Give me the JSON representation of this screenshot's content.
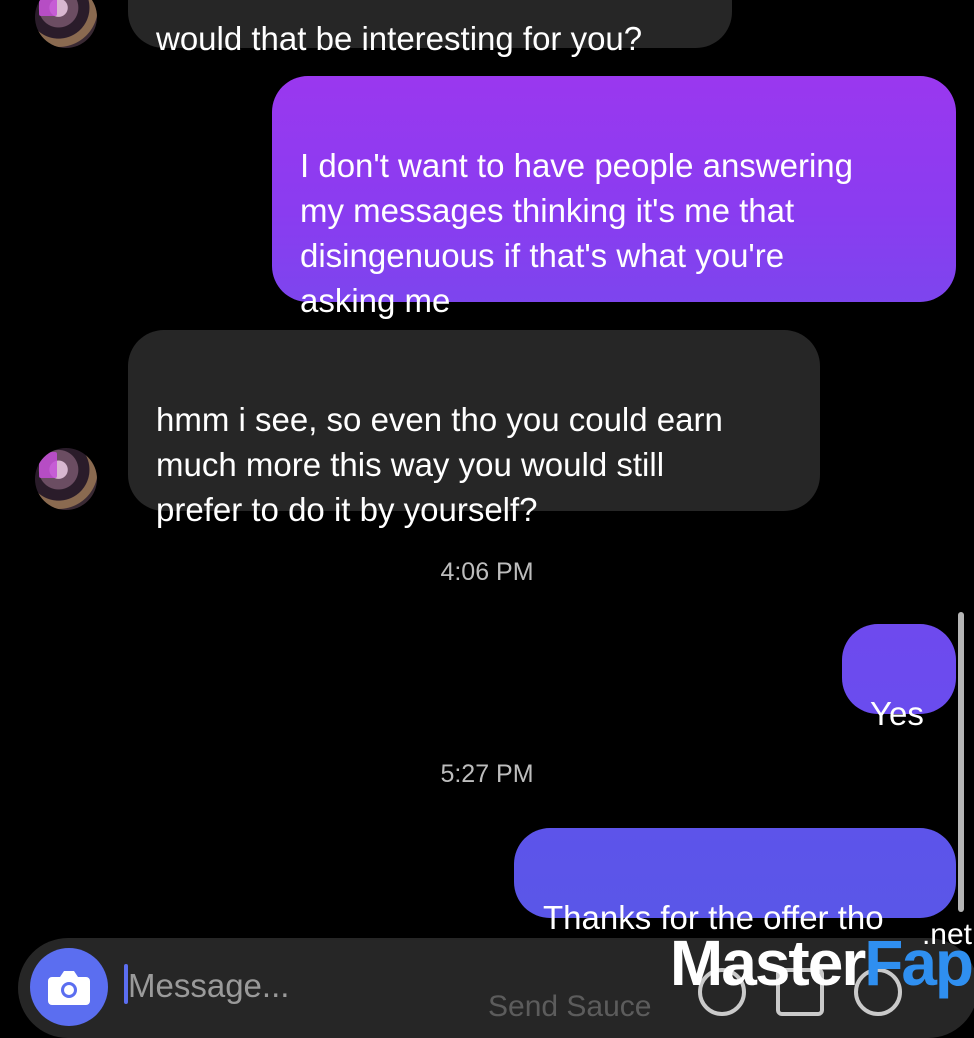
{
  "colors": {
    "background": "#000000",
    "incoming_bubble": "#262626",
    "outgoing_gradient_top": "#9b3cf0",
    "outgoing_gradient_mid": "#7a3cf0",
    "outgoing_gradient_bottom": "#5b52ea",
    "timestamp": "#bdbdbd",
    "camera_button": "#5b6ef0"
  },
  "messages": [
    {
      "direction": "incoming",
      "text": "would that be interesting for you?"
    },
    {
      "direction": "outgoing",
      "text": "I don't want to have people answering\nmy messages thinking it's me that\ndisingenuous if that's what you're\nasking me"
    },
    {
      "direction": "incoming",
      "text": "hmm i see, so even tho you could earn\nmuch more this way you would still\nprefer to do it by yourself?"
    },
    {
      "direction": "timestamp",
      "text": "4:06 PM"
    },
    {
      "direction": "outgoing",
      "text": "Yes"
    },
    {
      "direction": "timestamp",
      "text": "5:27 PM"
    },
    {
      "direction": "outgoing",
      "text": "Thanks for the offer tho"
    }
  ],
  "composer": {
    "placeholder": "Message...",
    "camera_icon": "camera-icon",
    "faded_hint": "Send Sauce",
    "tool_icons": [
      "microphone-icon",
      "image-icon",
      "plus-icon"
    ]
  },
  "watermark": {
    "part1": "Master",
    "part2": "Fap",
    "suffix": ".net"
  }
}
